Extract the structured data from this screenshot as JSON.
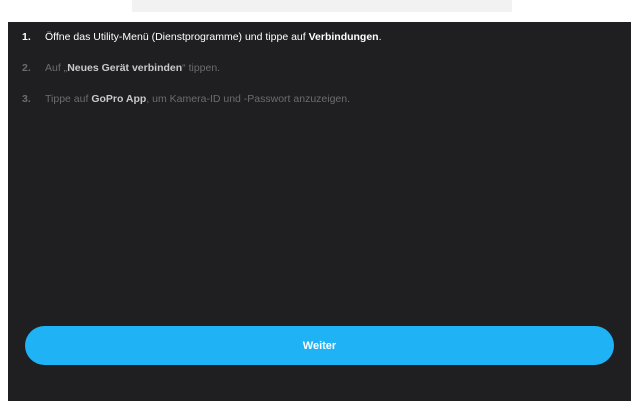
{
  "steps": [
    {
      "number": "1.",
      "before": "Öffne das Utility-Menü (Dienstprogramme) und tippe auf ",
      "bold": "Verbindungen",
      "after": "."
    },
    {
      "number": "2.",
      "before": "Auf „",
      "bold": "Neues Gerät verbinden",
      "after": "“ tippen."
    },
    {
      "number": "3.",
      "before": "Tippe auf ",
      "bold": "GoPro App",
      "after": ", um Kamera-ID und -Passwort anzuzeigen."
    }
  ],
  "continue_button": {
    "label": "Weiter"
  },
  "colors": {
    "panel_bg": "#1f1f22",
    "active_text": "#ffffff",
    "dim_text": "#6c6c70",
    "button_accent": "#1fb3f5"
  }
}
